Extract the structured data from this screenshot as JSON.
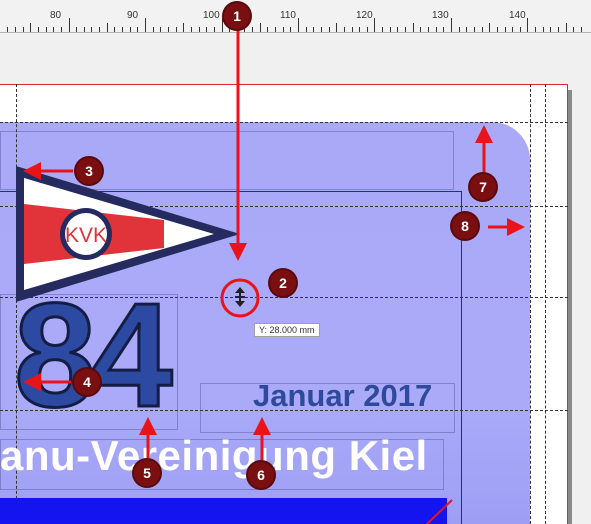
{
  "ruler": {
    "labels": [
      "80",
      "90",
      "100",
      "110",
      "120",
      "130",
      "140"
    ]
  },
  "tooltip": {
    "text": "Y: 28.000 mm"
  },
  "document": {
    "logo_text": "KVK",
    "year_text": "84",
    "month_text": "Januar 2017",
    "club_text": "anu-Vereinigung Kiel"
  },
  "markers": [
    "1",
    "2",
    "3",
    "4",
    "5",
    "6",
    "7",
    "8"
  ],
  "colors": {
    "marker": "#7a0f12",
    "arrow": "#e8141a",
    "card": "#a9a9f7",
    "bar": "#1414f0",
    "pennant_red": "#e0343a",
    "pennant_navy": "#252b5e"
  },
  "icons": {
    "cursor": "move-vertical-cursor-icon"
  }
}
